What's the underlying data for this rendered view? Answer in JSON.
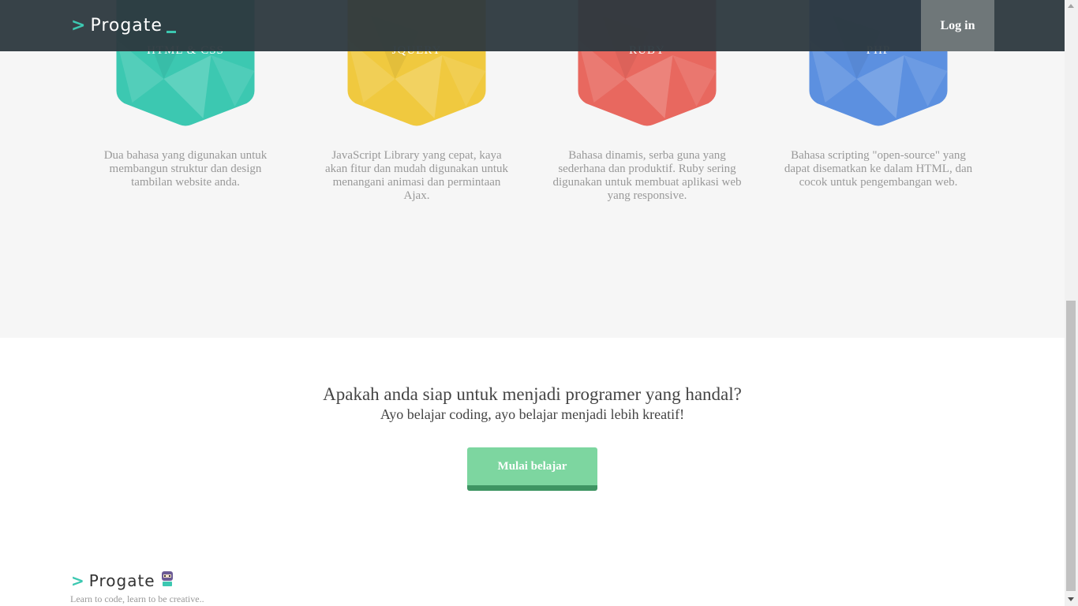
{
  "header": {
    "logo_chevron": ">",
    "logo_text": "Progate",
    "login_label": "Log in"
  },
  "courses": [
    {
      "label": "HTML & CSS",
      "description": "Dua bahasa yang digunakan untuk membangun struktur dan design tambilan website anda.",
      "color": "#3cc8b1"
    },
    {
      "label": "JQUERY",
      "description": "JavaScript Library yang cepat, kaya akan fitur dan mudah digunakan untuk menangani animasi dan permintaan Ajax.",
      "color": "#f0c93f"
    },
    {
      "label": "RUBY",
      "description": "Bahasa dinamis, serba guna yang sederhana dan produktif. Ruby sering digunakan untuk membuat aplikasi web yang responsive.",
      "color": "#e8685f"
    },
    {
      "label": "PHP",
      "description": "Bahasa scripting \"open-source\" yang dapat disematkan ke dalam HTML, dan cocok untuk pengembangan web.",
      "color": "#5c90e0"
    }
  ],
  "cta": {
    "title": "Apakah anda siap untuk menjadi programer yang handal?",
    "subtitle": "Ayo belajar coding, ayo belajar menjadi lebih kreatif!",
    "button_label": "Mulai belajar"
  },
  "footer": {
    "logo_chevron": ">",
    "logo_text": "Progate",
    "tagline": "Learn to code, learn to be creative.."
  },
  "colors": {
    "accent": "#3cc8b1",
    "header_bg": "#2c383e",
    "cta_button": "#7dd6a0"
  }
}
